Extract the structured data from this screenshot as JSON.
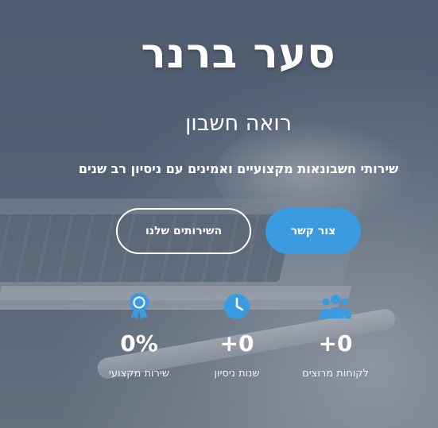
{
  "hero": {
    "title": "סער ברנר",
    "subtitle": "רואה חשבון",
    "tagline": "שירותי חשבונאות מקצועיים ואמינים עם ניסיון רב שנים"
  },
  "buttons": {
    "contact_label": "צור קשר",
    "services_label": "השירותים שלנו"
  },
  "stats": [
    {
      "icon": "users-icon",
      "value": "+0",
      "label": "לקוחות מרוצים"
    },
    {
      "icon": "clock-icon",
      "value": "+0",
      "label": "שנות ניסיון"
    },
    {
      "icon": "award-icon",
      "value": "0%",
      "label": "שירות מקצועי"
    }
  ],
  "colors": {
    "accent": "#3b9be0",
    "text": "#ffffff"
  }
}
